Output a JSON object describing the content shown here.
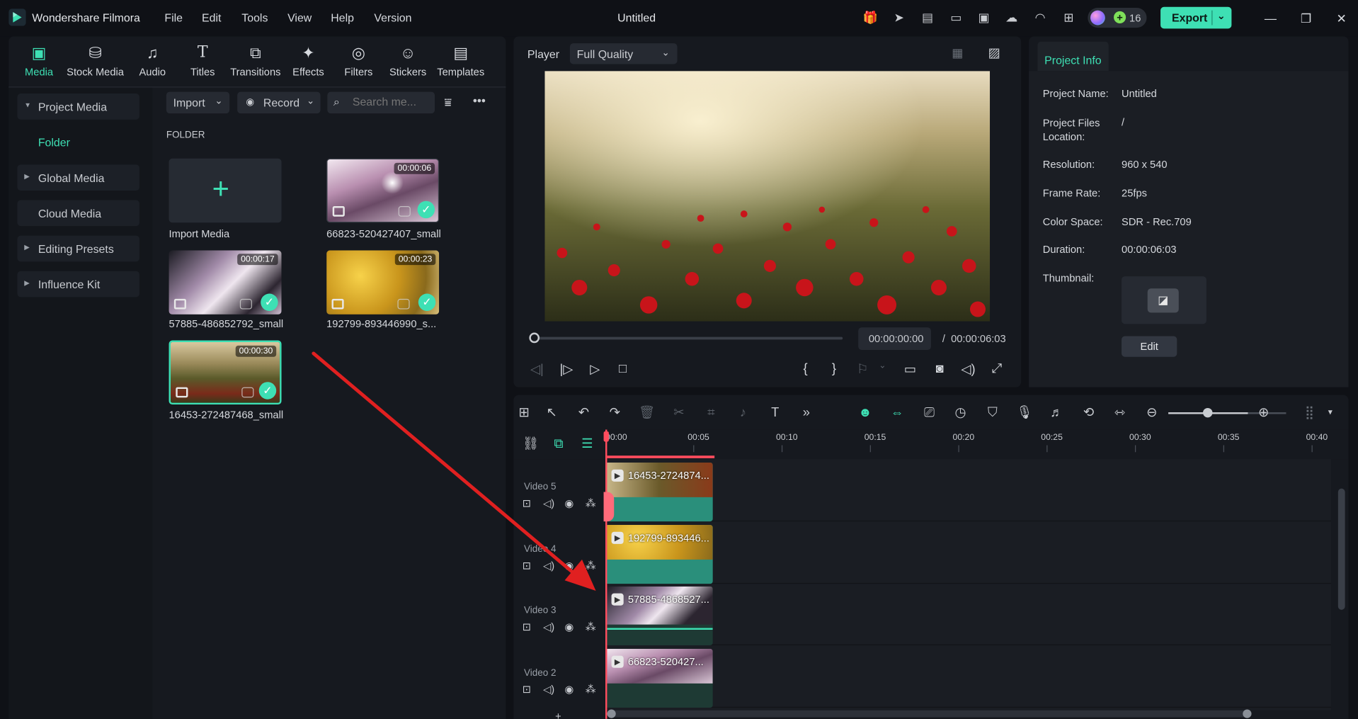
{
  "app": {
    "name": "Wondershare Filmora",
    "doc_title": "Untitled"
  },
  "menu": [
    "File",
    "Edit",
    "Tools",
    "View",
    "Help",
    "Version"
  ],
  "credits": "16",
  "export_label": "Export",
  "top_tabs": [
    "Media",
    "Stock Media",
    "Audio",
    "Titles",
    "Transitions",
    "Effects",
    "Filters",
    "Stickers",
    "Templates"
  ],
  "sidebar": {
    "project_media": "Project Media",
    "folder": "Folder",
    "items": [
      "Global Media",
      "Cloud Media",
      "Editing Presets",
      "Influence Kit"
    ]
  },
  "media": {
    "import_label": "Import",
    "record_label": "Record",
    "search_placeholder": "Search me...",
    "folder_title": "FOLDER",
    "import_media_label": "Import Media",
    "cards": [
      {
        "name": "66823-520427407_small",
        "duration": "00:00:06"
      },
      {
        "name": "57885-486852792_small",
        "duration": "00:00:17"
      },
      {
        "name": "192799-893446990_s...",
        "duration": "00:00:23"
      },
      {
        "name": "16453-272487468_small",
        "duration": "00:00:30"
      }
    ]
  },
  "player": {
    "label": "Player",
    "quality": "Full Quality",
    "current_time": "00:00:00:00",
    "total_time": "00:00:06:03",
    "separator": "/"
  },
  "project_info": {
    "tab": "Project Info",
    "rows": [
      {
        "label": "Project Name:",
        "value": "Untitled"
      },
      {
        "label": "Project Files Location:",
        "value": "/"
      },
      {
        "label": "Resolution:",
        "value": "960 x 540"
      },
      {
        "label": "Frame Rate:",
        "value": "25fps"
      },
      {
        "label": "Color Space:",
        "value": "SDR - Rec.709"
      },
      {
        "label": "Duration:",
        "value": "00:00:06:03"
      }
    ],
    "thumbnail_label": "Thumbnail:",
    "edit_label": "Edit"
  },
  "timeline": {
    "ticks": [
      "00:00",
      "00:05",
      "00:10",
      "00:15",
      "00:20",
      "00:25",
      "00:30",
      "00:35",
      "00:40"
    ],
    "tracks": [
      {
        "name": "Video 5",
        "clip": "16453-2724874..."
      },
      {
        "name": "Video 4",
        "clip": "192799-893446..."
      },
      {
        "name": "Video 3",
        "clip": "57885-4868527..."
      },
      {
        "name": "Video 2",
        "clip": "66823-520427..."
      }
    ]
  },
  "colors": {
    "accent": "#3ee0b4",
    "playhead": "#ff4d5e",
    "arrow": "#e02020"
  }
}
